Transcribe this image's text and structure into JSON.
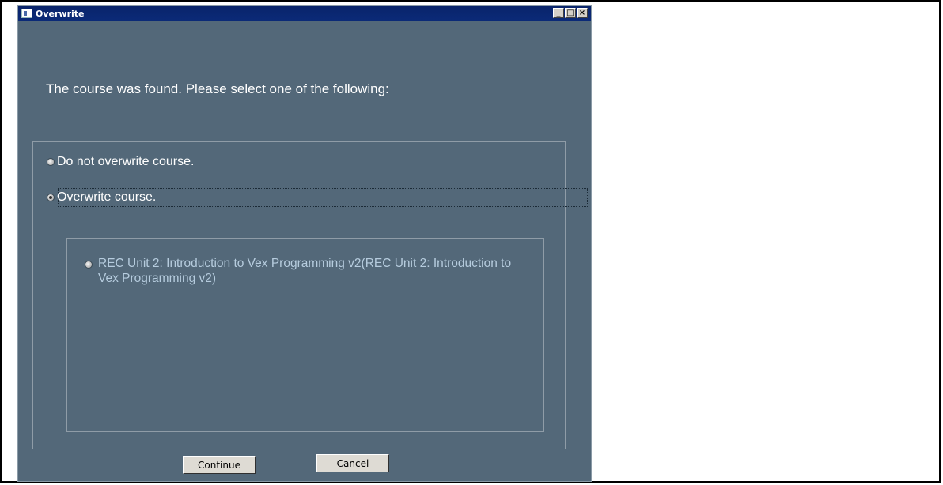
{
  "window": {
    "title": "Overwrite",
    "controls": {
      "minimize": "_",
      "maximize": "□",
      "close": "×"
    }
  },
  "dialog": {
    "heading": "The course was found. Please select one of the following:",
    "options": [
      {
        "label": "Do not overwrite course.",
        "selected": false
      },
      {
        "label": "Overwrite course.",
        "selected": true
      }
    ],
    "courses": [
      {
        "label": "REC Unit  2: Introduction to Vex Programming v2(REC Unit  2: Introduction to Vex Programming v2)",
        "selected": false
      }
    ]
  },
  "buttons": {
    "continue": "Continue",
    "cancel": "Cancel"
  }
}
